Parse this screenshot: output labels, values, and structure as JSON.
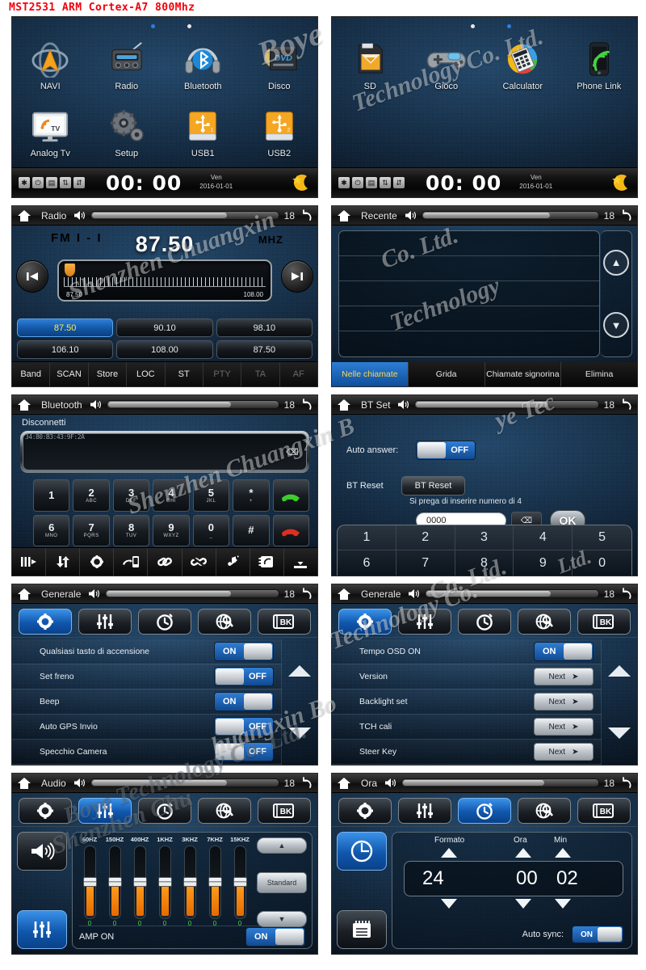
{
  "product_title": "MST2531 ARM Cortex-A7 800Mhz",
  "colors": {
    "accent_blue": "#1e6fd0",
    "title_red": "#f1000a",
    "eq_orange": "#ff9b1c",
    "eq_value_green": "#49d64a",
    "preset_active_text": "#ffe94a"
  },
  "watermarks": [
    "Shenzhen Chuangxin Boye Technology Co. Ltd.",
    "Boye"
  ],
  "screens": {
    "home1": {
      "apps": [
        {
          "label": "NAVI",
          "icon": "navigation-icon"
        },
        {
          "label": "Radio",
          "icon": "radio-icon"
        },
        {
          "label": "Bluetooth",
          "icon": "bluetooth-headset-icon"
        },
        {
          "label": "Disco",
          "icon": "dvd-drive-icon"
        },
        {
          "label": "Analog Tv",
          "icon": "tv-icon"
        },
        {
          "label": "Setup",
          "icon": "gears-icon"
        },
        {
          "label": "USB1",
          "icon": "usb-drive-icon"
        },
        {
          "label": "USB2",
          "icon": "usb-drive-icon"
        }
      ],
      "status": {
        "icons": [
          "bluetooth-icon",
          "power-icon",
          "list-icon",
          "route-icon",
          "route-alt-icon"
        ],
        "clock": "00: 00",
        "day": "Ven",
        "date": "2016-01-01",
        "night_icon": "moon-star-icon"
      }
    },
    "home2": {
      "apps": [
        {
          "label": "SD",
          "icon": "sd-card-icon"
        },
        {
          "label": "Gioco",
          "icon": "gamepad-icon"
        },
        {
          "label": "Calculator",
          "icon": "calculator-icon"
        },
        {
          "label": "Phone Link",
          "icon": "phone-link-icon"
        }
      ],
      "status": {
        "icons": [
          "bluetooth-icon",
          "power-icon",
          "list-icon",
          "route-icon",
          "route-alt-icon"
        ],
        "clock": "00: 00",
        "day": "Ven",
        "date": "2016-01-01",
        "night_icon": "moon-star-icon"
      }
    },
    "radio": {
      "titlebar": {
        "title": "Radio",
        "volume": "18"
      },
      "band": "FM I - I",
      "frequency": "87.50",
      "unit": "MHZ",
      "tuner_min": "87.50",
      "tuner_max": "108.00",
      "presets": [
        "87.50",
        "90.10",
        "98.10",
        "106.10",
        "108.00",
        "87.50"
      ],
      "active_preset_index": 0,
      "bottom_buttons": [
        {
          "label": "Band",
          "enabled": true
        },
        {
          "label": "SCAN",
          "enabled": true
        },
        {
          "label": "Store",
          "enabled": true
        },
        {
          "label": "LOC",
          "enabled": true
        },
        {
          "label": "ST",
          "enabled": true
        },
        {
          "label": "PTY",
          "enabled": false
        },
        {
          "label": "TA",
          "enabled": false
        },
        {
          "label": "AF",
          "enabled": false
        }
      ]
    },
    "recent": {
      "titlebar": {
        "title": "Recente",
        "volume": "18"
      },
      "rows": [
        "",
        "",
        "",
        "",
        ""
      ],
      "tabs": [
        {
          "label": "Nelle chiamate",
          "active": true
        },
        {
          "label": "Grida",
          "active": false
        },
        {
          "label": "Chiamate signorina",
          "active": false
        },
        {
          "label": "Elimina",
          "active": false
        }
      ],
      "scroll_up_icon": "chevron-up-icon",
      "scroll_down_icon": "chevron-down-icon"
    },
    "bluetooth": {
      "titlebar": {
        "title": "Bluetooth",
        "volume": "18"
      },
      "status_label": "Disconnetti",
      "input_value": "34:80:B3:43:9F:2A",
      "keys": [
        {
          "digit": "1",
          "sub": ""
        },
        {
          "digit": "2",
          "sub": "ABC"
        },
        {
          "digit": "3",
          "sub": "DEF"
        },
        {
          "digit": "4",
          "sub": "GHI"
        },
        {
          "digit": "5",
          "sub": "JKL"
        },
        {
          "digit": "*",
          "sub": "+"
        },
        {
          "digit": "6",
          "sub": "MNO"
        },
        {
          "digit": "7",
          "sub": "PQRS"
        },
        {
          "digit": "8",
          "sub": "TUV"
        },
        {
          "digit": "9",
          "sub": "WXYZ"
        },
        {
          "digit": "0",
          "sub": "_"
        },
        {
          "digit": "#",
          "sub": ""
        }
      ],
      "call_button": "call-answer-icon",
      "hangup_button": "call-end-icon",
      "toolbar_icons": [
        "keypad-icon",
        "download-sync-icon",
        "settings-gear-icon",
        "phone-transfer-icon",
        "link-icon",
        "unlink-icon",
        "music-note-icon",
        "phonebook-icon",
        "import-icon"
      ]
    },
    "btset": {
      "titlebar": {
        "title": "BT Set",
        "volume": "18"
      },
      "auto_answer_label": "Auto answer:",
      "auto_answer_value": "OFF",
      "bt_reset_label": "BT Reset",
      "bt_reset_button": "BT Reset",
      "pin_hint": "Si prega di inserire numero di 4",
      "pin_value": "0000",
      "delete_icon": "backspace-icon",
      "ok_label": "OK",
      "numpad": [
        "1",
        "2",
        "3",
        "4",
        "5",
        "6",
        "7",
        "8",
        "9",
        "0"
      ]
    },
    "generale1": {
      "titlebar": {
        "title": "Generale",
        "volume": "18"
      },
      "tabs": [
        {
          "icon": "gear-icon",
          "active": true
        },
        {
          "icon": "equalizer-icon",
          "active": false
        },
        {
          "icon": "clock-icon",
          "active": false
        },
        {
          "icon": "globe-search-icon",
          "active": false
        },
        {
          "icon": "bk-book-icon",
          "active": false,
          "label": "BK"
        }
      ],
      "rows": [
        {
          "label": "Qualsiasi tasto di accensione",
          "type": "toggle",
          "value": "ON"
        },
        {
          "label": "Set freno",
          "type": "toggle",
          "value": "OFF"
        },
        {
          "label": "Beep",
          "type": "toggle",
          "value": "ON"
        },
        {
          "label": "Auto GPS Invio",
          "type": "toggle",
          "value": "OFF"
        },
        {
          "label": "Specchio Camera",
          "type": "toggle",
          "value": "OFF"
        }
      ]
    },
    "generale2": {
      "titlebar": {
        "title": "Generale",
        "volume": "18"
      },
      "tabs": [
        {
          "icon": "gear-icon",
          "active": true
        },
        {
          "icon": "equalizer-icon",
          "active": false
        },
        {
          "icon": "clock-icon",
          "active": false
        },
        {
          "icon": "globe-search-icon",
          "active": false
        },
        {
          "icon": "bk-book-icon",
          "active": false,
          "label": "BK"
        }
      ],
      "rows": [
        {
          "label": "Tempo OSD ON",
          "type": "toggle",
          "value": "ON"
        },
        {
          "label": "Version",
          "type": "next",
          "value": "Next"
        },
        {
          "label": "Backlight set",
          "type": "next",
          "value": "Next"
        },
        {
          "label": "TCH cali",
          "type": "next",
          "value": "Next"
        },
        {
          "label": "Steer Key",
          "type": "next",
          "value": "Next"
        }
      ]
    },
    "audio": {
      "titlebar": {
        "title": "Audio",
        "volume": "18"
      },
      "tabs": [
        {
          "icon": "gear-icon",
          "active": false
        },
        {
          "icon": "equalizer-icon",
          "active": true
        },
        {
          "icon": "clock-icon",
          "active": false
        },
        {
          "icon": "globe-search-icon",
          "active": false
        },
        {
          "icon": "bk-book-icon",
          "active": false,
          "label": "BK"
        }
      ],
      "side_buttons": [
        {
          "icon": "speaker-icon",
          "active": false
        },
        {
          "icon": "equalizer-icon",
          "active": true
        }
      ],
      "preset_label": "Standard",
      "amp_label": "AMP ON",
      "amp_value": "ON",
      "eq": {
        "bands": [
          "60HZ",
          "150HZ",
          "400HZ",
          "1KHZ",
          "3KHZ",
          "7KHZ",
          "15KHZ"
        ],
        "values": [
          0,
          0,
          0,
          0,
          0,
          0,
          0
        ]
      }
    },
    "ora": {
      "titlebar": {
        "title": "Ora",
        "volume": "18"
      },
      "tabs": [
        {
          "icon": "gear-icon",
          "active": false
        },
        {
          "icon": "equalizer-icon",
          "active": false
        },
        {
          "icon": "clock-icon",
          "active": true
        },
        {
          "icon": "globe-search-icon",
          "active": false
        },
        {
          "icon": "bk-book-icon",
          "active": false,
          "label": "BK"
        }
      ],
      "side_buttons": [
        {
          "icon": "clock-icon",
          "active": true
        },
        {
          "icon": "calendar-icon",
          "active": false
        }
      ],
      "headers": {
        "format": "Formato",
        "hour": "Ora",
        "minute": "Min"
      },
      "values": {
        "format": "24",
        "hour": "00",
        "minute": "02"
      },
      "auto_sync_label": "Auto sync:",
      "auto_sync_value": "ON"
    }
  }
}
